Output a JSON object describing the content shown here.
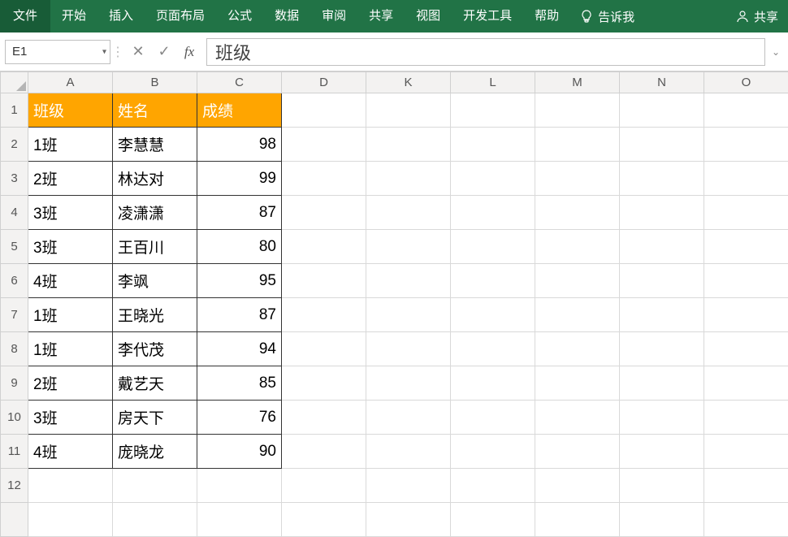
{
  "ribbon": {
    "file": "文件",
    "tabs": [
      "开始",
      "插入",
      "页面布局",
      "公式",
      "数据",
      "审阅",
      "共享",
      "视图",
      "开发工具",
      "帮助"
    ],
    "tellme": "告诉我",
    "share": "共享"
  },
  "formula_bar": {
    "name_box": "E1",
    "cancel": "✕",
    "confirm": "✓",
    "fx": "fx",
    "content": "班级"
  },
  "columns": [
    "A",
    "B",
    "C",
    "D",
    "K",
    "L",
    "M",
    "N",
    "O"
  ],
  "headers": {
    "class": "班级",
    "name": "姓名",
    "score": "成绩"
  },
  "rows": [
    {
      "class": "1班",
      "name": "李慧慧",
      "score": "98"
    },
    {
      "class": "2班",
      "name": "林达对",
      "score": "99"
    },
    {
      "class": "3班",
      "name": "凌潇潇",
      "score": "87"
    },
    {
      "class": "3班",
      "name": "王百川",
      "score": "80"
    },
    {
      "class": "4班",
      "name": "李飒",
      "score": "95"
    },
    {
      "class": "1班",
      "name": "王晓光",
      "score": "87"
    },
    {
      "class": "1班",
      "name": "李代茂",
      "score": "94"
    },
    {
      "class": "2班",
      "name": "戴艺天",
      "score": "85"
    },
    {
      "class": "3班",
      "name": "房天下",
      "score": "76"
    },
    {
      "class": "4班",
      "name": "庞晓龙",
      "score": "90"
    }
  ]
}
